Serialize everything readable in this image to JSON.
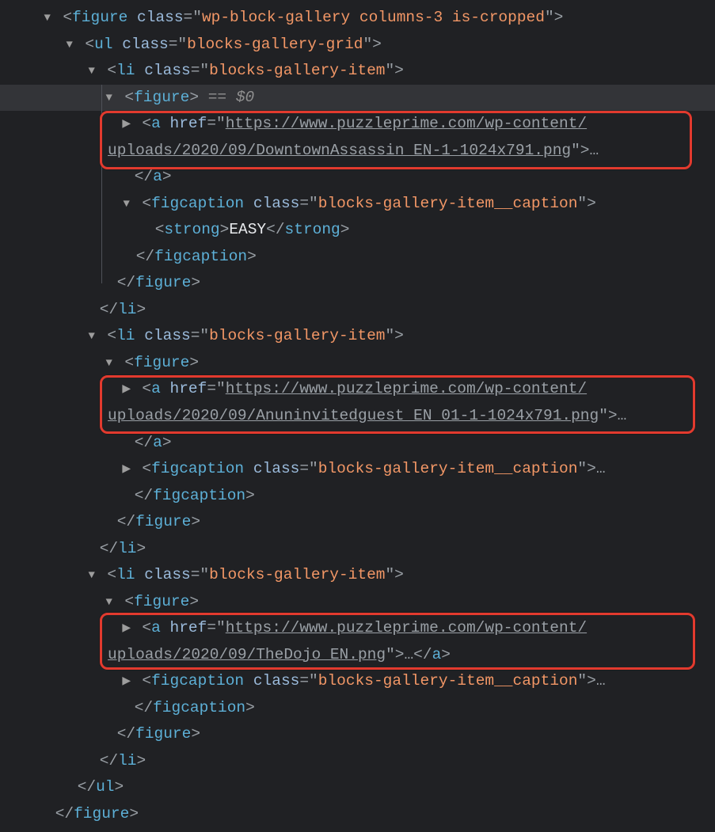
{
  "devtools": {
    "selected_marker": "== $0",
    "ellipsis": "…",
    "expand_open": "▼",
    "expand_closed": "▶"
  },
  "tags": {
    "figure": "figure",
    "ul": "ul",
    "li": "li",
    "a": "a",
    "figcaption": "figcaption",
    "strong": "strong"
  },
  "attrs": {
    "class": "class",
    "href": "href"
  },
  "vals": {
    "outer_figure_class": "wp-block-gallery columns-3 is-cropped",
    "ul_class": "blocks-gallery-grid",
    "li_class": "blocks-gallery-item",
    "caption_class": "blocks-gallery-item__caption",
    "href1a": "https://www.puzzleprime.com/wp-content/",
    "href1b": "uploads/2020/09/DowntownAssassin_EN-1-1024x791.png",
    "href2a": "https://www.puzzleprime.com/wp-content/",
    "href2b": "uploads/2020/09/Anuninvitedguest_EN_01-1-1024x791.png",
    "href3a": "https://www.puzzleprime.com/wp-content/",
    "href3b": "uploads/2020/09/TheDojo_EN.png",
    "strong_text": "EASY"
  }
}
